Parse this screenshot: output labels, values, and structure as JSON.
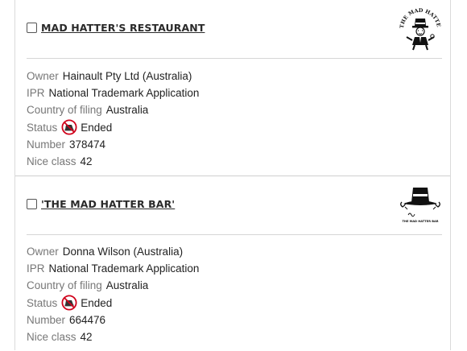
{
  "records": [
    {
      "title": "MAD HATTER'S RESTAURANT",
      "logo_text": "THE MAD HATTER'S RESTAURANT",
      "labels": {
        "owner": "Owner",
        "ipr": "IPR",
        "country": "Country of filing",
        "status": "Status",
        "number": "Number",
        "nice": "Nice class"
      },
      "owner": "Hainault Pty Ltd (Australia)",
      "ipr": "National Trademark Application",
      "country": "Australia",
      "status": "Ended",
      "status_icon": "ended-status-icon",
      "number": "378474",
      "nice_class": "42"
    },
    {
      "title": "'THE MAD HATTER BAR'",
      "logo_text": "THE MAD HATTER BAR",
      "labels": {
        "owner": "Owner",
        "ipr": "IPR",
        "country": "Country of filing",
        "status": "Status",
        "number": "Number",
        "nice": "Nice class"
      },
      "owner": "Donna Wilson (Australia)",
      "ipr": "National Trademark Application",
      "country": "Australia",
      "status": "Ended",
      "status_icon": "ended-status-icon",
      "number": "664476",
      "nice_class": "42"
    }
  ],
  "colors": {
    "label": "#777777",
    "value": "#222222",
    "status_ended": "#d0021b",
    "divider": "#d6d6d6"
  }
}
